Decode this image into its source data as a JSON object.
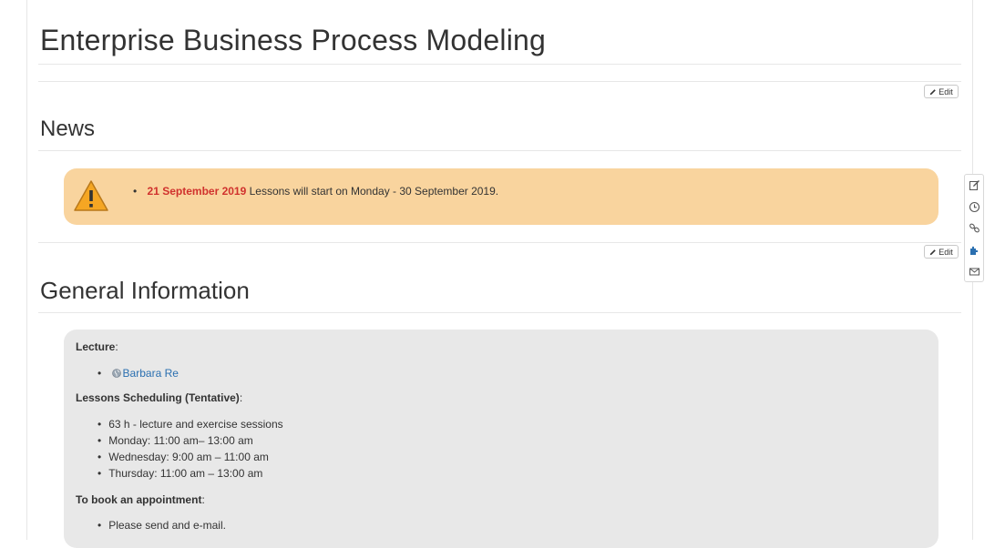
{
  "page": {
    "title": "Enterprise Business Process Modeling"
  },
  "edit_label": "Edit",
  "news": {
    "title": "News",
    "items": [
      {
        "date": "21 September 2019",
        "text": " Lessons will start on Monday - 30 September 2019."
      }
    ]
  },
  "general": {
    "title": "General Information",
    "lecture_label": "Lecture",
    "lecturer": "Barbara Re",
    "schedule_label": "Lessons Scheduling (Tentative)",
    "schedule": [
      "63 h - lecture and exercise sessions",
      "Monday: 11:00 am– 13:00 am",
      "Wednesday: 9:00 am – 11:00 am",
      "Thursday: 11:00 am – 13:00 am"
    ],
    "appointment_label": "To book an appointment",
    "appointment": [
      "Please send and e-mail."
    ]
  },
  "colors": {
    "news_bg": "#f9d49e",
    "date": "#d0312d",
    "link": "#2a6fb0",
    "info_bg": "#e8e8e8"
  },
  "icons": [
    "pencil-icon",
    "warning-icon",
    "globe-icon",
    "edit-page-icon",
    "history-icon",
    "link-icon",
    "plugin-icon",
    "mail-icon"
  ]
}
